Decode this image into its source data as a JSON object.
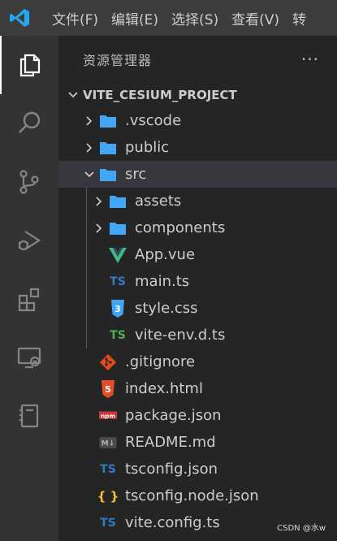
{
  "menu": {
    "items": [
      "文件(F)",
      "编辑(E)",
      "选择(S)",
      "查看(V)",
      "转"
    ]
  },
  "explorer": {
    "title": "资源管理器",
    "more": "···",
    "project": "VITE_CESIUM_PROJECT",
    "items": [
      {
        "label": ".vscode",
        "icon": "folder-icon"
      },
      {
        "label": "public",
        "icon": "folder-icon"
      },
      {
        "label": "src",
        "icon": "folder-open-icon"
      },
      {
        "label": "assets",
        "icon": "folder-icon"
      },
      {
        "label": "components",
        "icon": "folder-icon"
      },
      {
        "label": "App.vue",
        "icon": "vue-icon"
      },
      {
        "label": "main.ts",
        "icon": "ts-icon"
      },
      {
        "label": "style.css",
        "icon": "css-icon"
      },
      {
        "label": "vite-env.d.ts",
        "icon": "ts-definition-icon"
      },
      {
        "label": ".gitignore",
        "icon": "git-icon"
      },
      {
        "label": "index.html",
        "icon": "html-icon"
      },
      {
        "label": "package.json",
        "icon": "npm-icon"
      },
      {
        "label": "README.md",
        "icon": "markdown-icon"
      },
      {
        "label": "tsconfig.json",
        "icon": "ts-config-icon"
      },
      {
        "label": "tsconfig.node.json",
        "icon": "json-icon"
      },
      {
        "label": "vite.config.ts",
        "icon": "ts-icon"
      }
    ]
  },
  "icons": {
    "ts_text": "TS",
    "json_text": "{ }",
    "css_text": "3",
    "html_text": "5",
    "npm_text": "npm",
    "md_text": "M↓"
  },
  "colors": {
    "folder": "#90a4ae",
    "ts": "#3178c6",
    "vue": "#41b883",
    "css": "#42a5f5",
    "git": "#e64a19",
    "html": "#e44d26",
    "npm": "#cb3837",
    "json": "#fbc02d"
  },
  "watermark": "CSDN @水w"
}
